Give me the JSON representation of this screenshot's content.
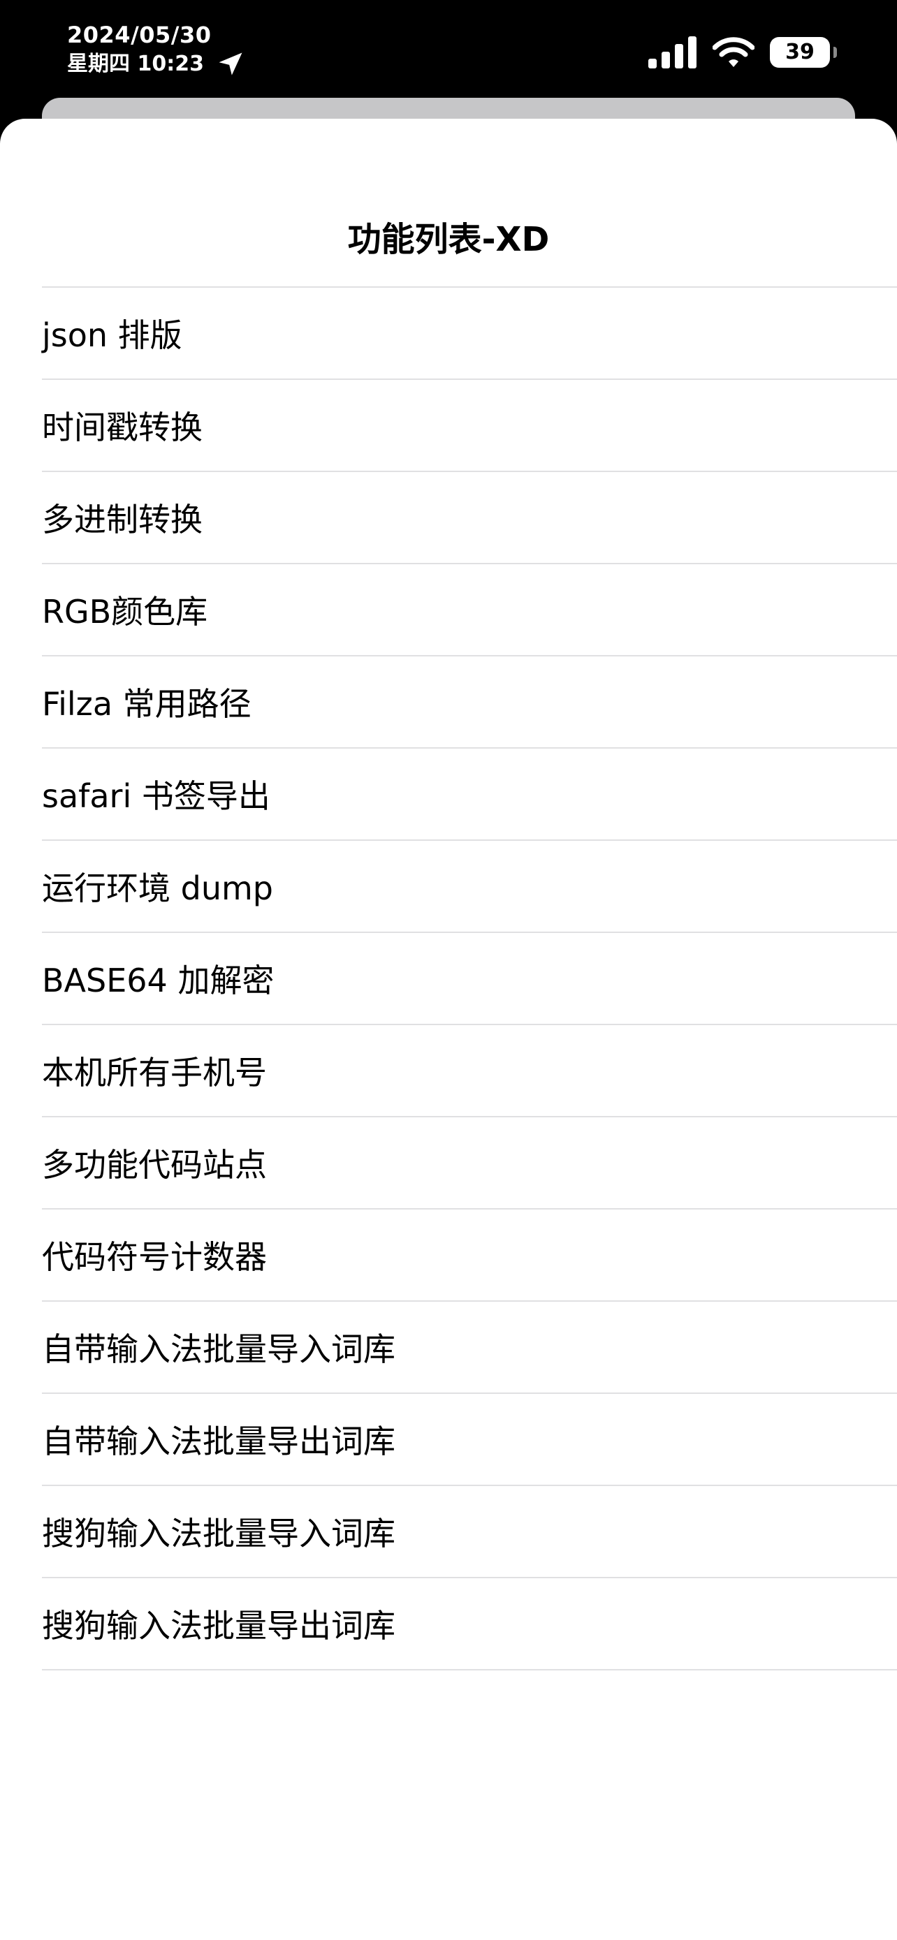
{
  "status_bar": {
    "date": "2024/05/30",
    "time": "星期四 10:23",
    "battery": "39",
    "icons": [
      "location-arrow-icon",
      "cellular-signal-icon",
      "wifi-icon",
      "battery-icon"
    ]
  },
  "sheet": {
    "title": "功能列表-XD",
    "items": [
      {
        "label": "json 排版"
      },
      {
        "label": "时间戳转换"
      },
      {
        "label": "多进制转换"
      },
      {
        "label": "RGB颜色库"
      },
      {
        "label": "Filza 常用路径"
      },
      {
        "label": "safari 书签导出"
      },
      {
        "label": "运行环境 dump"
      },
      {
        "label": "BASE64 加解密"
      },
      {
        "label": "本机所有手机号"
      },
      {
        "label": "多功能代码站点"
      },
      {
        "label": "代码符号计数器"
      },
      {
        "label": "自带输入法批量导入词库"
      },
      {
        "label": "自带输入法批量导出词库"
      },
      {
        "label": "搜狗输入法批量导入词库"
      },
      {
        "label": "搜狗输入法批量导出词库"
      }
    ]
  },
  "colors": {
    "background": "#000000",
    "sheet": "#ffffff",
    "separator": "#e0e0e2",
    "back_sheet": "#c6c6c8"
  }
}
